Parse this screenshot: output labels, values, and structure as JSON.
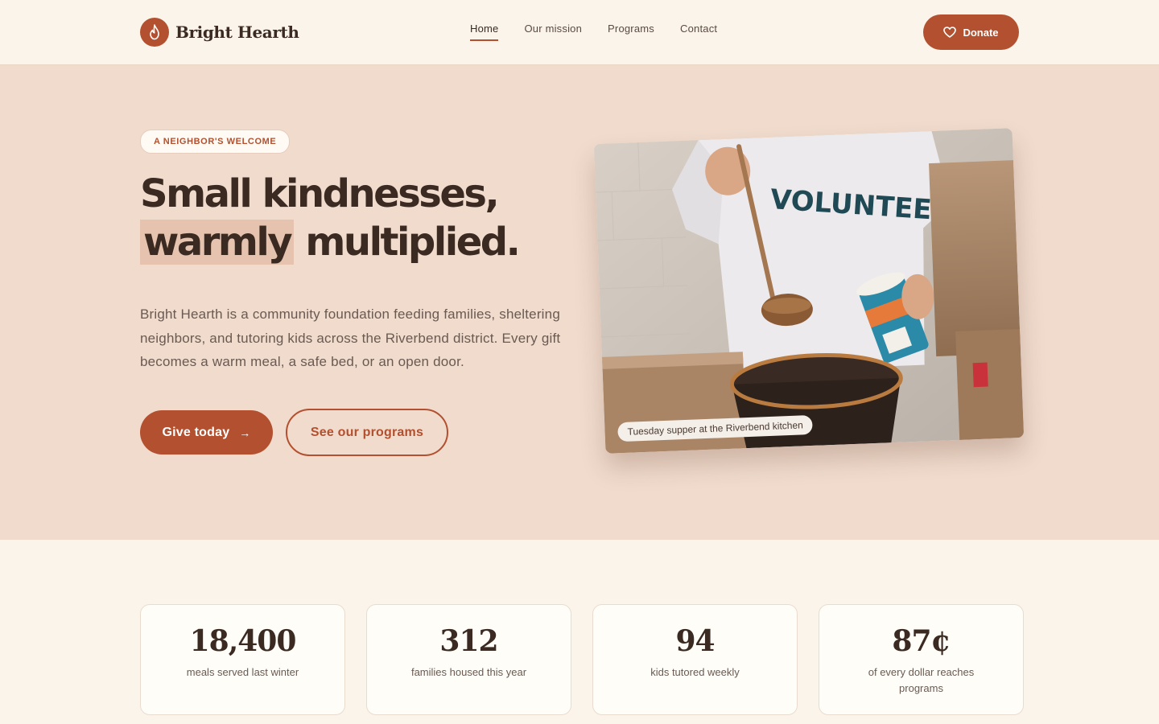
{
  "brand": {
    "name": "Bright Hearth",
    "accent": "#b2502f"
  },
  "nav": {
    "items": [
      {
        "label": "Home",
        "active": true
      },
      {
        "label": "Our mission"
      },
      {
        "label": "Programs"
      },
      {
        "label": "Contact"
      }
    ],
    "donate_label": "Donate",
    "donate_icon": "heart-icon"
  },
  "hero": {
    "eyebrow": "A NEIGHBOR'S WELCOME",
    "headline_line1": "Small kindnesses,",
    "headline_highlight": "warmly",
    "headline_rest": " multiplied.",
    "lede": "Bright Hearth is a community foundation feeding families, sheltering neighbors, and tutoring kids across the Riverbend district. Every gift becomes a warm meal, a safe bed, or an open door.",
    "primary_cta": "Give today",
    "secondary_cta": "See our programs",
    "photo_caption": "Tuesday supper at the Riverbend kitchen",
    "photo_shirt_text": "VOLUNTEER"
  },
  "stats": [
    {
      "value": "18,400",
      "label": "meals served last winter"
    },
    {
      "value": "312",
      "label": "families housed this year"
    },
    {
      "value": "94",
      "label": "kids tutored weekly"
    },
    {
      "value": "87¢",
      "label": "of every dollar reaches programs"
    }
  ]
}
